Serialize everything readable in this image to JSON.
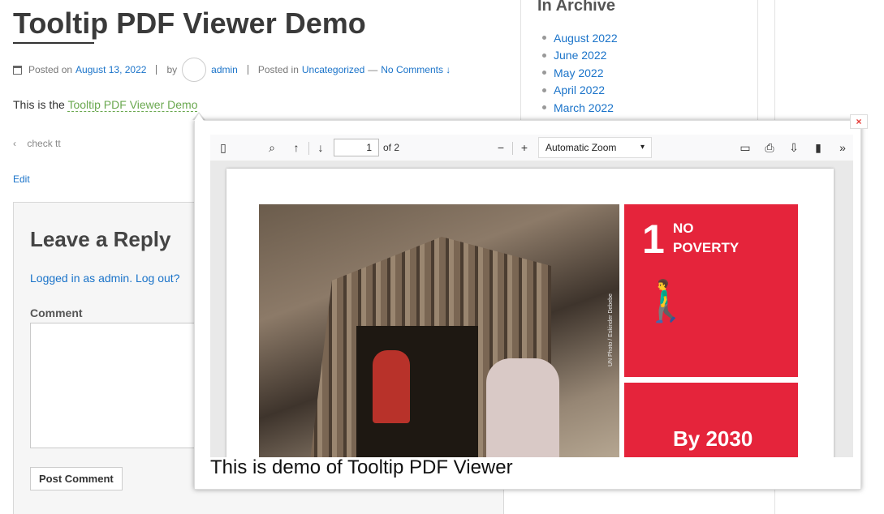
{
  "post": {
    "title": "Tooltip PDF Viewer Demo",
    "posted_on_label": "Posted on",
    "date": "August 13, 2022",
    "by_label": "by",
    "author": "admin",
    "posted_in_label": "Posted in",
    "category": "Uncategorized",
    "dash": "—",
    "comments_link": "No Comments ↓",
    "body_prefix": "This is the",
    "body_link": "Tooltip PDF Viewer Demo",
    "prev_arrow": "‹",
    "prev_label": "check tt",
    "edit_label": "Edit"
  },
  "comments": {
    "reply_title": "Leave a Reply",
    "logged_in_text": "Logged in as admin.",
    "logout_text": "Log out?",
    "comment_label": "Comment",
    "submit_label": "Post Comment"
  },
  "sidebar": {
    "archive_title": "In Archive",
    "archives": [
      "August 2022",
      "June 2022",
      "May 2022",
      "April 2022",
      "March 2022"
    ]
  },
  "tooltip": {
    "close_label": "×",
    "caption": "This is demo of Tooltip PDF Viewer",
    "viewer": {
      "page_current": "1",
      "page_total_text": "of 2",
      "zoom_value": "Automatic Zoom"
    },
    "pdf_content": {
      "goal_number": "1",
      "goal_title_line1": "NO",
      "goal_title_line2": "POVERTY",
      "target_text": "By 2030",
      "photo_credit": "UN Photo / Eskinder Debebe"
    }
  },
  "colors": {
    "link": "#1a73c9",
    "tooltip_link": "#6aa84f",
    "sdg_red": "#e5243b",
    "close_x": "#e53935"
  }
}
